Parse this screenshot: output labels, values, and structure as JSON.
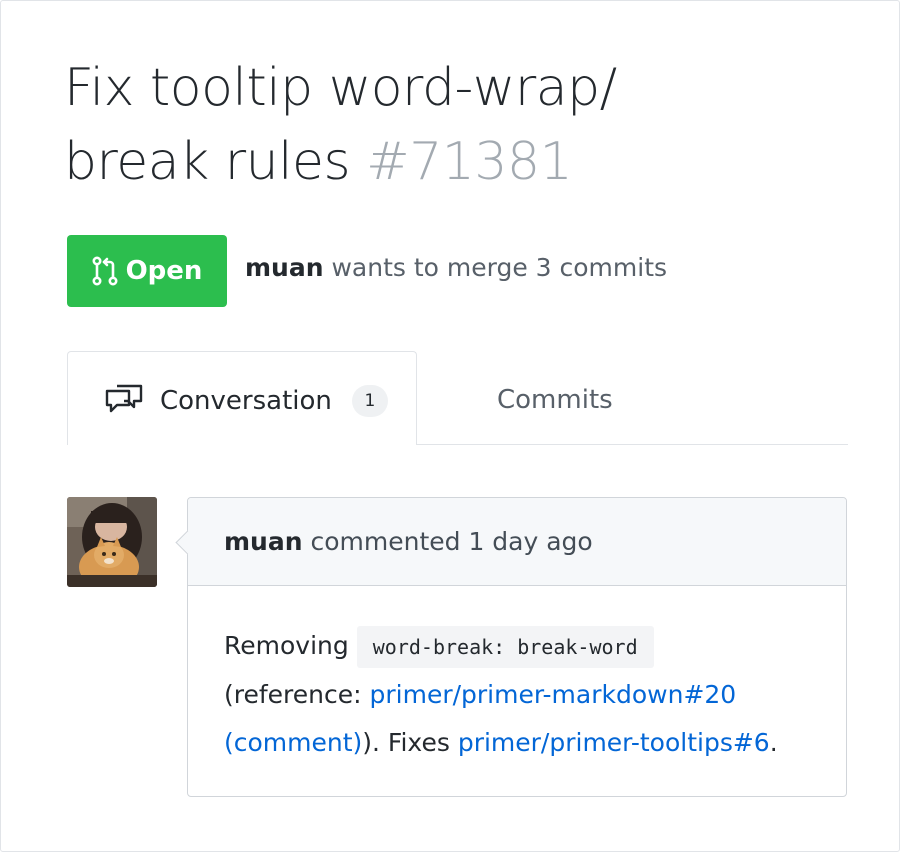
{
  "pull_request": {
    "title": "Fix tooltip word-wrap/ break rules",
    "number": "#71381",
    "state_label": "Open",
    "author": "muan",
    "merge_text": "wants to merge 3 commits",
    "state_color": "#2cbe4e"
  },
  "tabs": {
    "conversation_label": "Conversation",
    "conversation_count": "1",
    "commits_label": "Commits"
  },
  "comment": {
    "author": "muan",
    "action_time": "commented 1 day ago",
    "body_prefix": "Removing",
    "code": "word-break: break-word",
    "ref_prefix": "(reference: ",
    "link1": "primer/primer-markdown#20 (comment)",
    "mid_text": "). Fixes ",
    "link2": "primer/primer-tooltips#6",
    "end_text": "."
  },
  "icons": [
    "git-pull-request-icon",
    "comment-discussion-icon"
  ],
  "colors": {
    "link": "#0366d6",
    "muted": "#586069"
  }
}
